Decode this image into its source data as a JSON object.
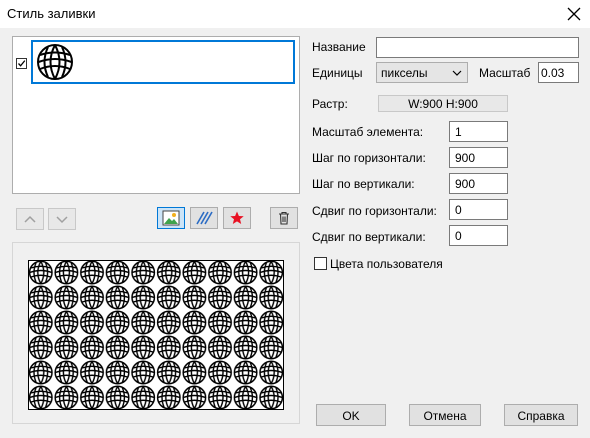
{
  "window": {
    "title": "Стиль заливки"
  },
  "fields": {
    "name_label": "Название",
    "name_value": "",
    "units_label": "Единицы",
    "units_value": "пикселы",
    "scale_label": "Масштаб",
    "scale_value": "0.03",
    "raster_label": "Растр:",
    "raster_value": "W:900  H:900",
    "element_scale_label": "Масштаб элемента:",
    "element_scale_value": "1",
    "h_step_label": "Шаг по горизонтали:",
    "h_step_value": "900",
    "v_step_label": "Шаг по вертикали:",
    "v_step_value": "900",
    "h_offset_label": "Сдвиг по горизонтали:",
    "h_offset_value": "0",
    "v_offset_label": "Сдвиг по вертикали:",
    "v_offset_value": "0",
    "user_colors_label": "Цвета пользователя"
  },
  "buttons": {
    "ok": "OK",
    "cancel": "Отмена",
    "help": "Справка"
  },
  "colors": {
    "accent": "#0078d7",
    "star": "#e81123",
    "hatch": "#2b6cc4"
  }
}
